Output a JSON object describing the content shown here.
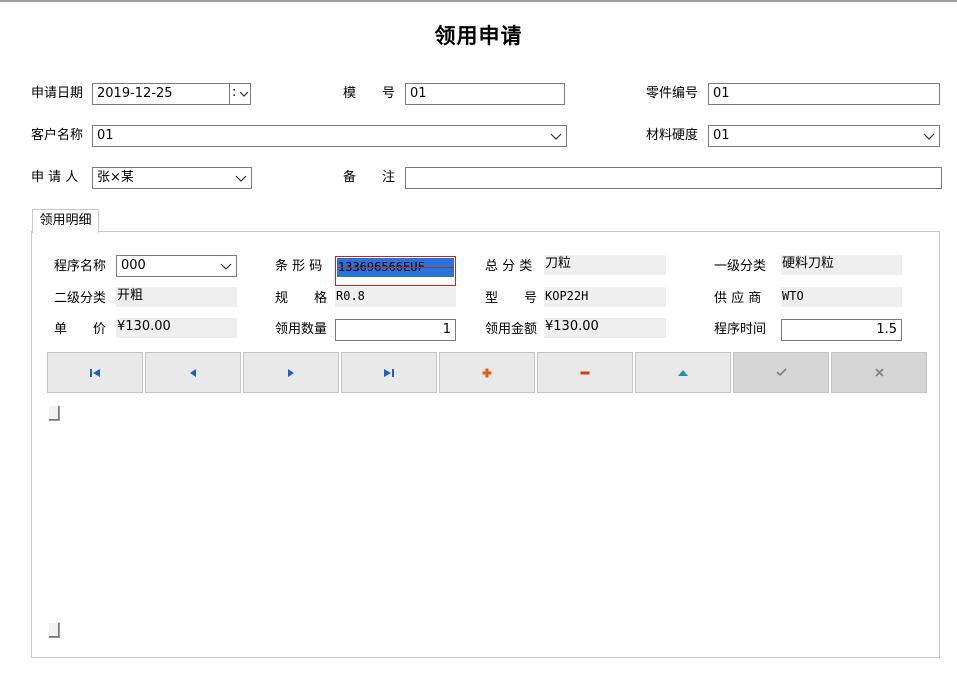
{
  "title": "领用申请",
  "header": {
    "apply_date": {
      "label": "申请日期",
      "value": "2019-12-25",
      "btn": ":"
    },
    "mold_no": {
      "label": "模　　号",
      "value": "01"
    },
    "part_no": {
      "label": "零件编号",
      "value": "01"
    },
    "customer": {
      "label": "客户名称",
      "value": "01"
    },
    "hardness": {
      "label": "材料硬度",
      "value": "01"
    },
    "applicant": {
      "label": "申 请 人",
      "value": "张×某"
    },
    "remark": {
      "label": "备　　注",
      "value": ""
    }
  },
  "tab": {
    "label": "领用明细"
  },
  "detail": {
    "program_name": {
      "label": "程序名称",
      "value": "000"
    },
    "barcode": {
      "label": "条 形 码",
      "value": "133696566EUF"
    },
    "category": {
      "label": "总 分 类",
      "value": "刀粒"
    },
    "level1": {
      "label": "一级分类",
      "value": "硬料刀粒"
    },
    "level2": {
      "label": "二级分类",
      "value": "开粗"
    },
    "spec": {
      "label": "规　　格",
      "value": "R0.8"
    },
    "model": {
      "label": "型　　号",
      "value": "KOP22H"
    },
    "supplier": {
      "label": "供 应 商",
      "value": "WTO"
    },
    "unit_price": {
      "label": "单　　价",
      "value": "¥130.00"
    },
    "quantity": {
      "label": "领用数量",
      "value": "1"
    },
    "amount": {
      "label": "领用金额",
      "value": "¥130.00"
    },
    "program_time": {
      "label": "程序时间",
      "value": "1.5"
    }
  },
  "navigator": {
    "buttons": [
      {
        "name": "first-record-button",
        "icon": "first-icon",
        "enabled": true
      },
      {
        "name": "prior-record-button",
        "icon": "prior-icon",
        "enabled": true
      },
      {
        "name": "next-record-button",
        "icon": "next-icon",
        "enabled": true
      },
      {
        "name": "last-record-button",
        "icon": "last-icon",
        "enabled": true
      },
      {
        "name": "insert-record-button",
        "icon": "plus-icon",
        "enabled": true
      },
      {
        "name": "delete-record-button",
        "icon": "minus-icon",
        "enabled": true
      },
      {
        "name": "edit-record-button",
        "icon": "up-triangle-icon",
        "enabled": true
      },
      {
        "name": "post-record-button",
        "icon": "check-icon",
        "enabled": false
      },
      {
        "name": "cancel-record-button",
        "icon": "x-icon",
        "enabled": false
      }
    ],
    "colors": {
      "nav": "#1f5fbf",
      "plus": "#e06010",
      "minus": "#d04010",
      "edit": "#2090b0",
      "disabled": "#808080"
    }
  }
}
